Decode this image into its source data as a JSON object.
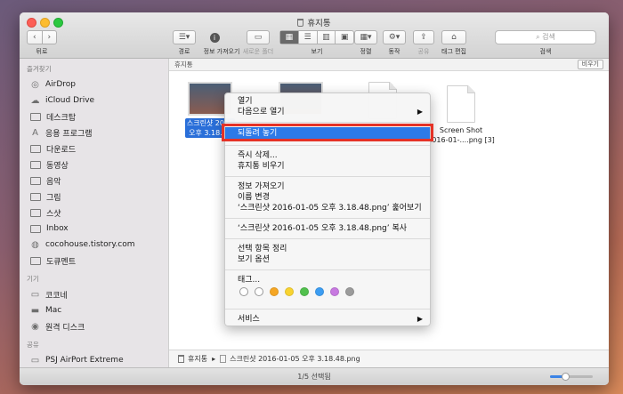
{
  "window": {
    "title": "휴지통"
  },
  "toolbar": {
    "nav_label": "뒤로",
    "getinfo_label": "정보 가져오기",
    "newfolder_label": "새로운 폴더",
    "view_label": "보기",
    "arrange_label": "정렬",
    "action_label": "동작",
    "share_label": "공유",
    "tag_label": "태그 편집",
    "search_placeholder": "검색",
    "search_label": "검색",
    "path_label": "경로",
    "colors": {
      "view_active": "#6a6a6a"
    }
  },
  "sidebar": {
    "favorites_header": "즐겨찾기",
    "favorites": [
      {
        "icon": "airdrop-icon",
        "label": "AirDrop"
      },
      {
        "icon": "cloud-icon",
        "label": "iCloud Drive"
      },
      {
        "icon": "folder-icon",
        "label": "데스크탑"
      },
      {
        "icon": "apps-icon",
        "label": "응용 프로그램"
      },
      {
        "icon": "folder-icon",
        "label": "다운로드"
      },
      {
        "icon": "folder-icon",
        "label": "동영상"
      },
      {
        "icon": "folder-icon",
        "label": "음악"
      },
      {
        "icon": "folder-icon",
        "label": "그림"
      },
      {
        "icon": "folder-icon",
        "label": "스샷"
      },
      {
        "icon": "folder-icon",
        "label": "Inbox"
      },
      {
        "icon": "globe-icon",
        "label": "cocohouse.tistory.com"
      },
      {
        "icon": "folder-icon",
        "label": "도큐멘트"
      }
    ],
    "devices_header": "기기",
    "devices": [
      {
        "icon": "computer-icon",
        "label": "코코네"
      },
      {
        "icon": "disk-icon",
        "label": "Mac"
      },
      {
        "icon": "disc-icon",
        "label": "원격 디스크"
      }
    ],
    "shared_header": "공유",
    "shared": [
      {
        "icon": "airport-icon",
        "label": "PSJ AirPort Extreme"
      },
      {
        "icon": "computer-icon",
        "label": "bp009e02d35686"
      }
    ]
  },
  "content": {
    "header": "휴지통",
    "view_button": "비우기",
    "files": [
      {
        "name_line1": "스크린샷 2016",
        "name_line2": "오후 3.18.48",
        "selected": true
      },
      {
        "name_line1": "",
        "name_line2": "",
        "selected": false
      },
      {
        "name_line1": "",
        "name_line2": "",
        "selected": false
      },
      {
        "name_line1": "Screen Shot",
        "name_line2": "2016-01-....png [3]",
        "selected": false
      }
    ]
  },
  "context_menu": {
    "open": "열기",
    "open_with": "다음으로 열기",
    "put_back": "되돌려 놓기",
    "delete_now": "즉시 삭제...",
    "empty_trash": "휴지통 비우기",
    "get_info": "정보 가져오기",
    "rename": "이름 변경",
    "quick_look": "‘스크린샷 2016-01-05 오후 3.18.48.png’ 훑어보기",
    "copy": "‘스크린샷 2016-01-05 오후 3.18.48.png’ 복사",
    "clean_up": "선택 항목 정리",
    "view_options": "보기 옵션",
    "tags": "태그...",
    "services": "서비스",
    "tag_colors": [
      "#ffffff",
      "#ffffff",
      "#f5a623",
      "#f8d330",
      "#51c04d",
      "#3c9df2",
      "#c779e0",
      "#9b9b9b"
    ],
    "highlight_color": "#2d7ae8",
    "annotation_box_color": "#e53226"
  },
  "pathbar": {
    "root": "휴지통",
    "separator": "▸",
    "file": "스크린샷 2016-01-05 오후 3.18.48.png"
  },
  "status": {
    "text": "1/5 선택됨",
    "zoom_fraction": 0.35
  }
}
